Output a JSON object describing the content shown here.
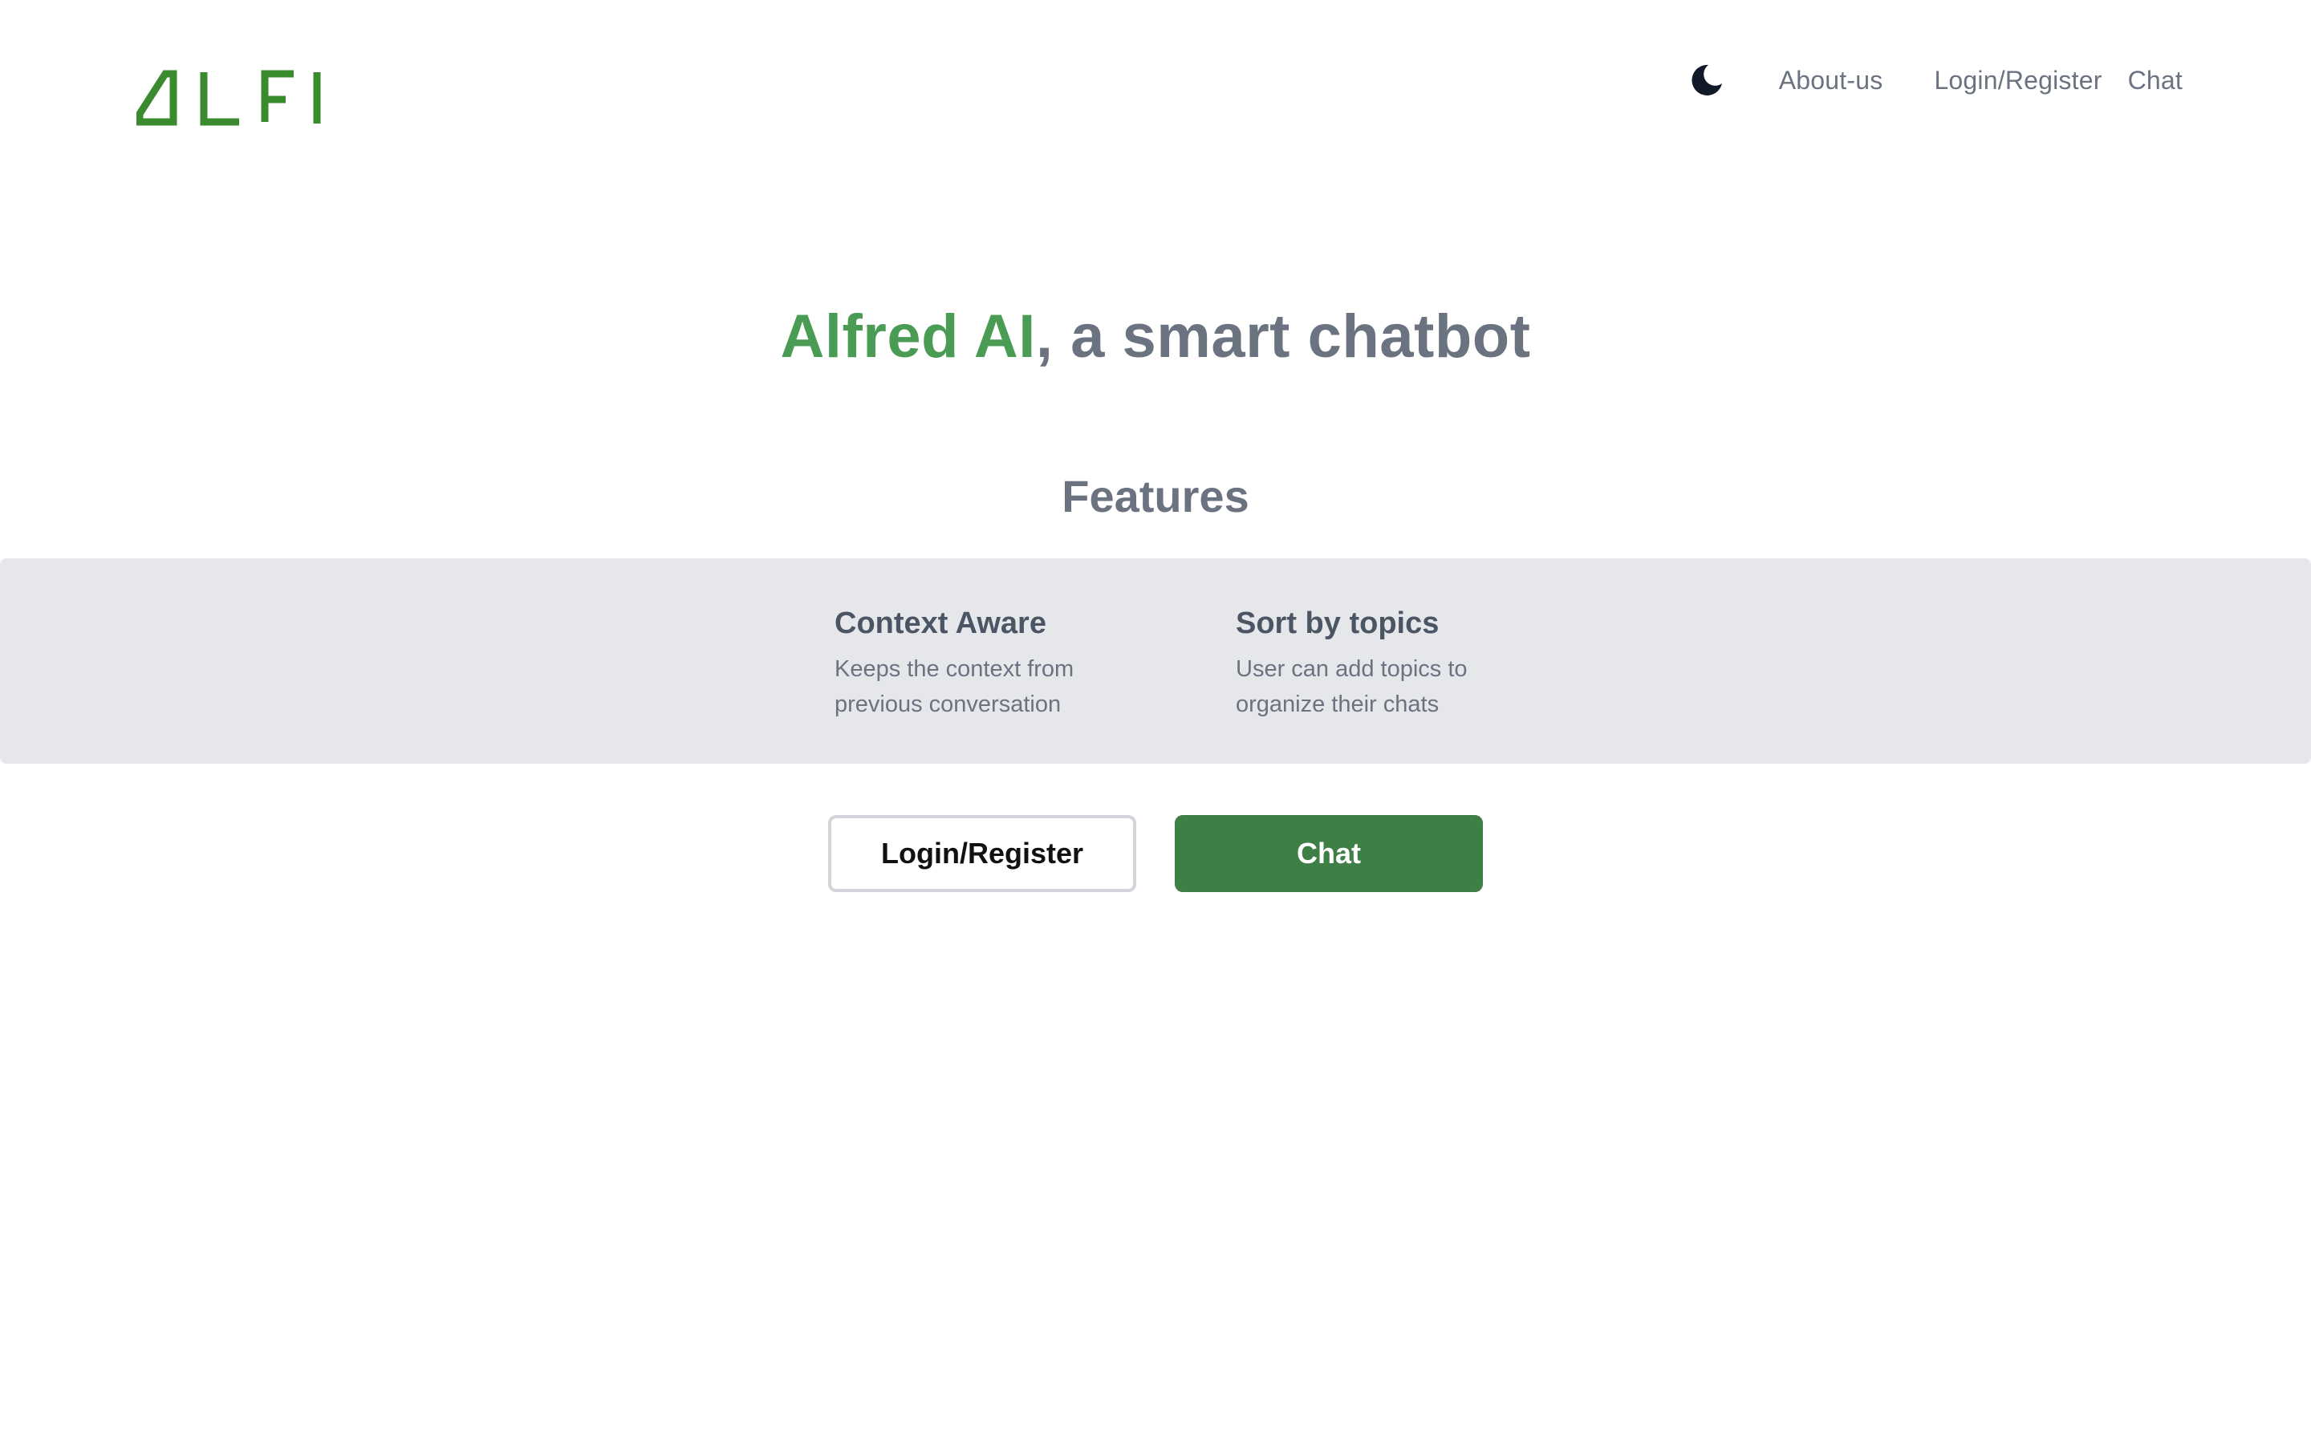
{
  "colors": {
    "accent": "#4a9b54",
    "muted": "#6b7280",
    "band": "#e5e7eb",
    "primary": "#3e7f46",
    "logo": "#3a8a2e",
    "moon": "#111827"
  },
  "header": {
    "logo_text": "ALFI",
    "theme_toggle_icon": "moon-icon",
    "nav": {
      "about": "About-us",
      "login": "Login/Register",
      "chat": "Chat"
    }
  },
  "hero": {
    "accent": "Alfred AI",
    "rest": ", a smart chatbot"
  },
  "features": {
    "title": "Features",
    "items": [
      {
        "title": "Context Aware",
        "description": "Keeps the context from previous conversation"
      },
      {
        "title": "Sort by topics",
        "description": "User can add topics to organize their chats"
      }
    ]
  },
  "actions": {
    "login_label": "Login/Register",
    "chat_label": "Chat"
  }
}
